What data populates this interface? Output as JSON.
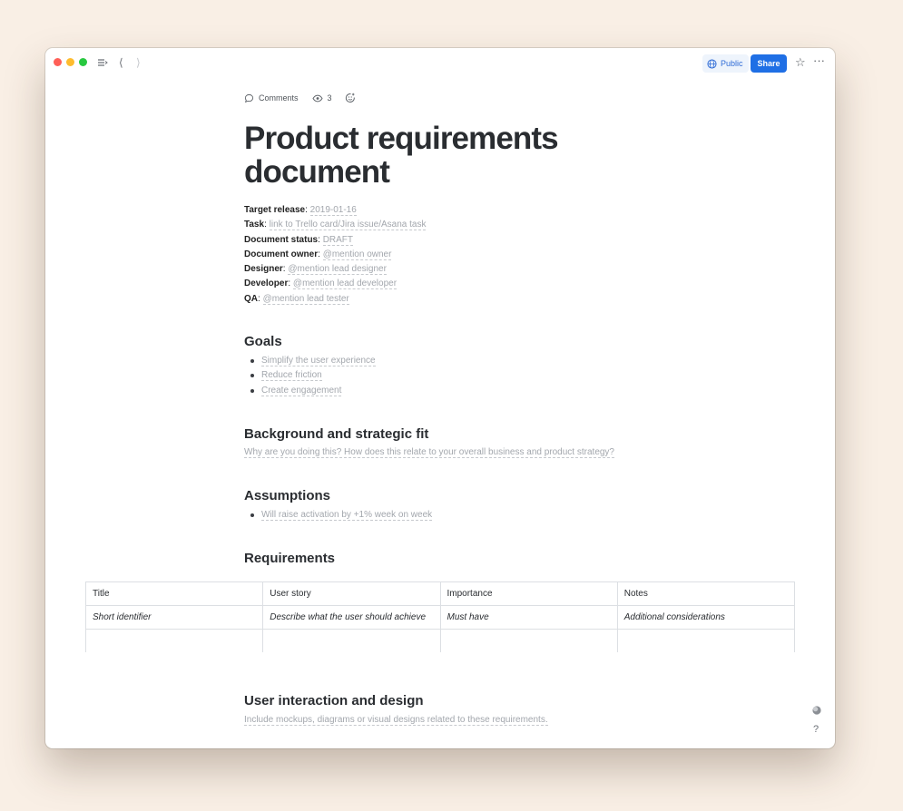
{
  "toolbar": {
    "public_label": "Public",
    "share_label": "Share"
  },
  "meta": {
    "comments_label": "Comments",
    "views_count": "3"
  },
  "document": {
    "title": "Product requirements document",
    "properties": [
      {
        "key": "Target release",
        "value": "2019-01-16"
      },
      {
        "key": "Task",
        "value": "link to Trello card/Jira issue/Asana task"
      },
      {
        "key": "Document status",
        "value": "DRAFT"
      },
      {
        "key": "Document owner",
        "value": "@mention owner"
      },
      {
        "key": "Designer",
        "value": "@mention lead designer"
      },
      {
        "key": "Developer",
        "value": "@mention lead developer"
      },
      {
        "key": "QA",
        "value": "@mention lead tester"
      }
    ],
    "goals": {
      "heading": "Goals",
      "items": [
        "Simplify the user experience",
        "Reduce friction",
        "Create engagement"
      ]
    },
    "background": {
      "heading": "Background and strategic fit",
      "description": "Why are you doing this? How does this relate to your overall business and product strategy?"
    },
    "assumptions": {
      "heading": "Assumptions",
      "items": [
        "Will raise activation by +1% week on week"
      ]
    },
    "requirements": {
      "heading": "Requirements",
      "columns": [
        "Title",
        "User story",
        "Importance",
        "Notes"
      ],
      "rows": [
        [
          "Short identifier",
          "Describe what the user should achieve",
          "Must have",
          "Additional considerations"
        ]
      ]
    },
    "interaction": {
      "heading": "User interaction and design",
      "description": "Include mockups, diagrams or visual designs related to these requirements."
    }
  },
  "help_label": "?",
  "colors": {
    "background": "#f9efe5",
    "accent": "#1f6fe5",
    "placeholder": "#a3a7ad"
  }
}
